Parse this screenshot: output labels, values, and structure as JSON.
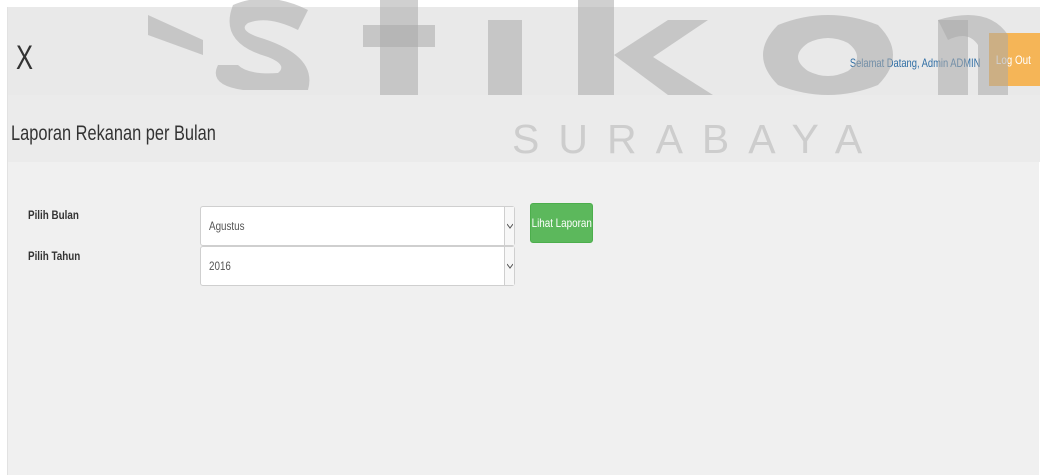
{
  "header": {
    "close_glyph": "X",
    "welcome_text": "Selamat Datang, Admin ADMIN",
    "logout_label": "Log Out",
    "logout_icon": "sign-out-icon",
    "logout_color": "#f5b557"
  },
  "watermark": {
    "brand": "stikom",
    "sub": "SURABAYA"
  },
  "page": {
    "title": "Laporan Rekanan per Bulan"
  },
  "form": {
    "month_label": "Pilih Bulan",
    "month_value": "Agustus",
    "year_label": "Pilih Tahun",
    "year_value": "2016",
    "submit_label": "Lihat Laporan",
    "submit_color": "#5cb85c"
  }
}
